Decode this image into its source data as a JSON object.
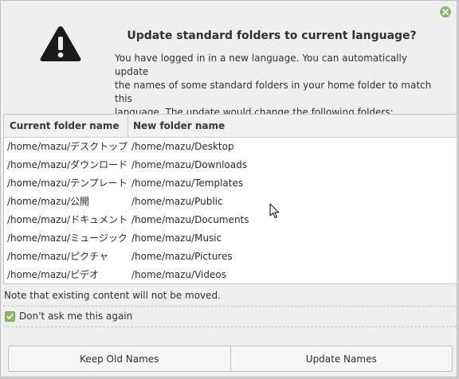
{
  "dialog": {
    "close_icon": "close-icon",
    "warning_icon": "warning-icon",
    "title": "Update standard folders to current language?",
    "message_lines": [
      "You have logged in in a new language. You can automatically update",
      "the names of some standard folders in your home folder to match this",
      "language. The update would change the following folders:"
    ]
  },
  "table": {
    "headers": {
      "current": "Current folder name",
      "new": "New folder name"
    },
    "rows": [
      {
        "current": "/home/mazu/デスクトップ",
        "new": "/home/mazu/Desktop"
      },
      {
        "current": "/home/mazu/ダウンロード",
        "new": "/home/mazu/Downloads"
      },
      {
        "current": "/home/mazu/テンプレート",
        "new": "/home/mazu/Templates"
      },
      {
        "current": "/home/mazu/公開",
        "new": "/home/mazu/Public"
      },
      {
        "current": "/home/mazu/ドキュメント",
        "new": "/home/mazu/Documents"
      },
      {
        "current": "/home/mazu/ミュージック",
        "new": "/home/mazu/Music"
      },
      {
        "current": "/home/mazu/ピクチャ",
        "new": "/home/mazu/Pictures"
      },
      {
        "current": "/home/mazu/ビデオ",
        "new": "/home/mazu/Videos"
      }
    ]
  },
  "note": "Note that existing content will not be moved.",
  "dont_ask": {
    "label": "Don't ask me this again",
    "checked": true
  },
  "buttons": {
    "keep": "Keep Old Names",
    "update": "Update Names"
  },
  "colors": {
    "accent": "#8fb66b",
    "background": "#efefef"
  }
}
